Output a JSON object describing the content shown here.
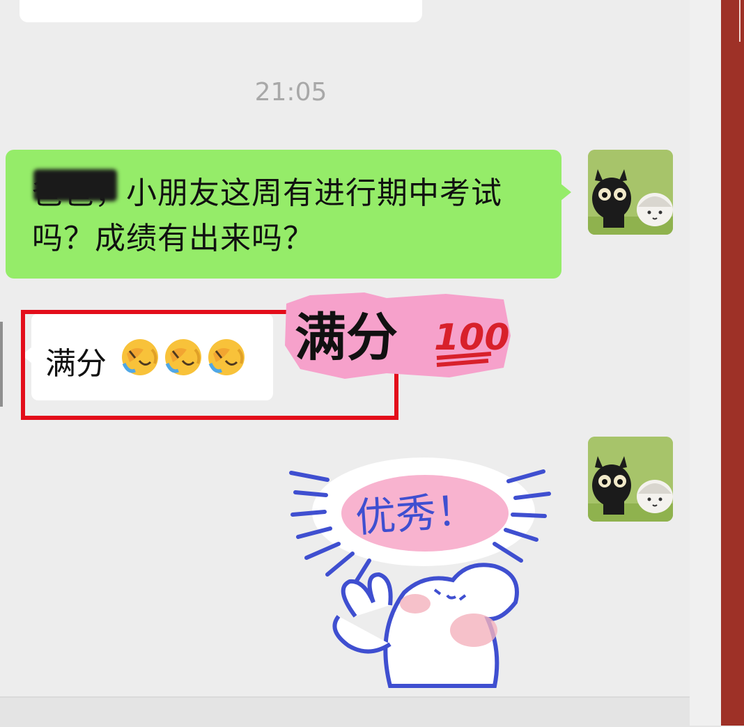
{
  "chat": {
    "timestamp": "21:05",
    "messages": [
      {
        "side": "right",
        "text": "爸爸，小朋友这周有进行期中考试吗？成绩有出来吗？",
        "bubble_color": "#95ec69"
      },
      {
        "side": "left",
        "text": "满分",
        "emoji": [
          "loudly-crying-face-icon",
          "loudly-crying-face-icon",
          "loudly-crying-face-icon"
        ],
        "bubble_color": "#ffffff"
      }
    ],
    "stickers": [
      {
        "name": "manfen-sticker",
        "text": "满分",
        "badge": "100"
      },
      {
        "name": "youxiu-sticker",
        "text": "优秀！"
      }
    ]
  },
  "annotation": {
    "color": "#e30d1a"
  },
  "colors": {
    "background": "#ededed",
    "accent_right_band": "#9e3127"
  }
}
